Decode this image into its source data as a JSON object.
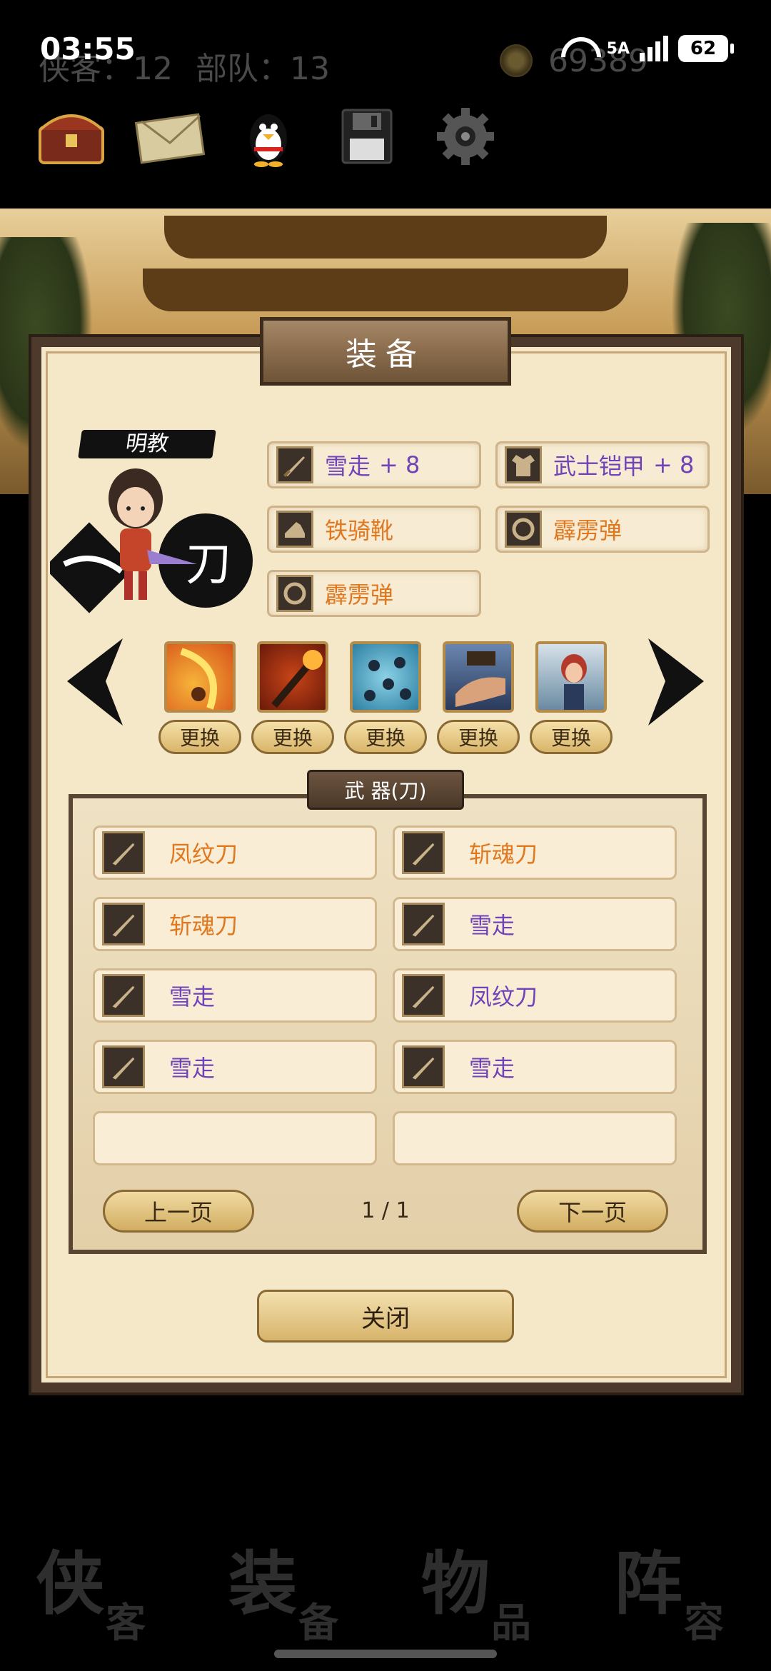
{
  "status": {
    "time": "03:55",
    "network": "5A",
    "battery": "62"
  },
  "hud": {
    "heroes": "侠客：12",
    "troops": "部队：13",
    "coins": "69389"
  },
  "toolbar": {
    "icons": [
      "treasure-chest-icon",
      "envelope-icon",
      "penguin-icon",
      "floppy-disk-icon",
      "gear-icon"
    ]
  },
  "panel": {
    "title": "装备"
  },
  "hero": {
    "sect": "明教",
    "weapon_glyph": "刀"
  },
  "equipment": [
    {
      "name": "雪走",
      "bonus": "+ 8",
      "icon": "sword-icon"
    },
    {
      "name": "武士铠甲",
      "bonus": "+ 8",
      "icon": "armor-icon"
    },
    {
      "name": "铁骑靴",
      "bonus": "",
      "icon": "boots-icon"
    },
    {
      "name": "霹雳弹",
      "bonus": "",
      "icon": "ring-icon"
    },
    {
      "name": "霹雳弹",
      "bonus": "",
      "icon": "ring-icon"
    }
  ],
  "skills": {
    "swap_label": "更换",
    "count": 5
  },
  "weapons": {
    "category_label": "武 器(刀)",
    "items": [
      {
        "name": "凤纹刀",
        "color": "#e07820"
      },
      {
        "name": "斩魂刀",
        "color": "#e07820"
      },
      {
        "name": "斩魂刀",
        "color": "#e07820"
      },
      {
        "name": "雪走",
        "color": "#7043b8"
      },
      {
        "name": "雪走",
        "color": "#7043b8"
      },
      {
        "name": "凤纹刀",
        "color": "#7043b8"
      },
      {
        "name": "雪走",
        "color": "#7043b8"
      },
      {
        "name": "雪走",
        "color": "#7043b8"
      }
    ],
    "prev_label": "上一页",
    "next_label": "下一页",
    "page_info": "1 / 1"
  },
  "close_label": "关闭",
  "bottom_nav": [
    {
      "big": "侠",
      "small": "客"
    },
    {
      "big": "装",
      "small": "备"
    },
    {
      "big": "物",
      "small": "品"
    },
    {
      "big": "阵",
      "small": "容"
    }
  ]
}
